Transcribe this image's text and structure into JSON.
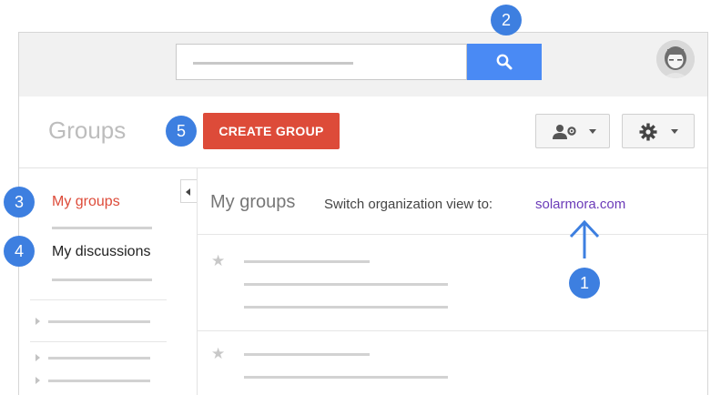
{
  "header": {
    "title": "Groups",
    "create_group_label": "CREATE GROUP"
  },
  "sidebar": {
    "my_groups_label": "My  groups",
    "my_discussions_label": "My discussions"
  },
  "main": {
    "title": "My groups",
    "switch_label": "Switch organization view to:",
    "org_link": "solarmora.com",
    "star_glyph": "★"
  },
  "annotations": {
    "one": "1",
    "two": "2",
    "three": "3",
    "four": "4",
    "five": "5"
  },
  "colors": {
    "accent_blue": "#4a8af4",
    "create_red": "#dd4b39",
    "link_purple": "#6b3bb8",
    "annotation_blue": "#3d7fe0"
  },
  "icons": [
    "search-icon",
    "avatar",
    "people-settings-icon",
    "gear-icon",
    "chevron-down-icon",
    "collapse-arrow-icon",
    "star-icon",
    "arrow-up-icon"
  ]
}
